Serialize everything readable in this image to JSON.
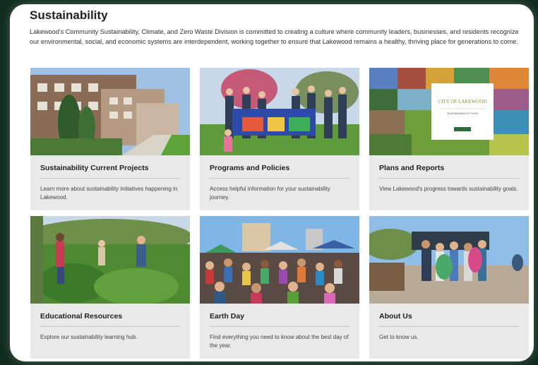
{
  "header": {
    "title": "Sustainability",
    "intro": "Lakewood's Community Sustainability, Climate, and Zero Waste Division is committed to creating a culture where community leaders, businesses, and residents recognize our environmental, social, and economic systems are interdependent, working together to ensure that Lakewood remains a healthy, thriving place for generations to come."
  },
  "cards": [
    {
      "title": "Sustainability Current Projects",
      "desc": "Learn more about sustainability initiatives happening in Lakewood."
    },
    {
      "title": "Programs and Policies",
      "desc": "Access helpful information for your sustainability journey."
    },
    {
      "title": "Plans and Reports",
      "desc": "View Lakewood's progress towards sustainability goals."
    },
    {
      "title": "Educational Resources",
      "desc": "Explore our sustainability learning hub."
    },
    {
      "title": "Earth Day",
      "desc": "Find everything you need to know about the best day of the year."
    },
    {
      "title": "About Us",
      "desc": "Get to know us."
    }
  ],
  "plan_cover": {
    "line1": "CITY OF LAKEWOOD",
    "line2": "SUSTAINABILITY PLAN"
  },
  "colors": {
    "card_bg": "#e9e9e9",
    "page_bg": "#0f2a1f"
  }
}
